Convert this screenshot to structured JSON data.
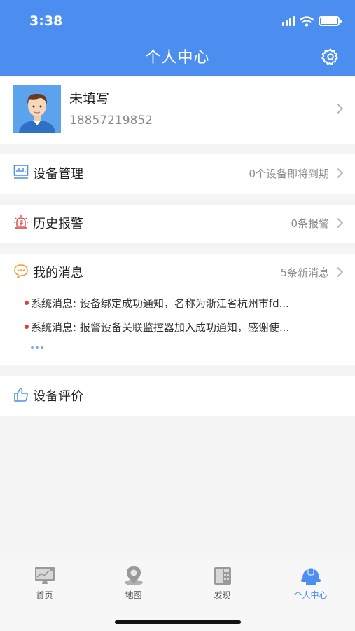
{
  "status_bar": {
    "time": "3:38"
  },
  "header": {
    "title": "个人中心",
    "settings_icon": "gear-icon"
  },
  "profile": {
    "name": "未填写",
    "phone": "18857219852",
    "avatar_icon": "user-avatar"
  },
  "menu": {
    "devices": {
      "label": "设备管理",
      "value": "0个设备即将到期",
      "icon": "monitor-chart-icon"
    },
    "alarms": {
      "label": "历史报警",
      "value": "0条报警",
      "icon": "alarm-light-icon"
    },
    "messages": {
      "label": "我的消息",
      "value": "5条新消息",
      "icon": "chat-bubble-icon",
      "items": [
        "系统消息: 设备绑定成功通知，名称为浙江省杭州市fd...",
        "系统消息: 报警设备关联监控器加入成功通知，感谢使..."
      ]
    },
    "review": {
      "label": "设备评价",
      "icon": "thumbs-up-icon"
    }
  },
  "tabbar": {
    "tabs": [
      {
        "label": "首页",
        "icon": "monitor-icon",
        "active": false
      },
      {
        "label": "地图",
        "icon": "map-pin-icon",
        "active": false
      },
      {
        "label": "发现",
        "icon": "fax-icon",
        "active": false
      },
      {
        "label": "个人中心",
        "icon": "helmet-icon",
        "active": true
      }
    ]
  },
  "colors": {
    "primary": "#4b8ef0",
    "alert_dot": "#e53935",
    "background": "#f4f4f4"
  }
}
